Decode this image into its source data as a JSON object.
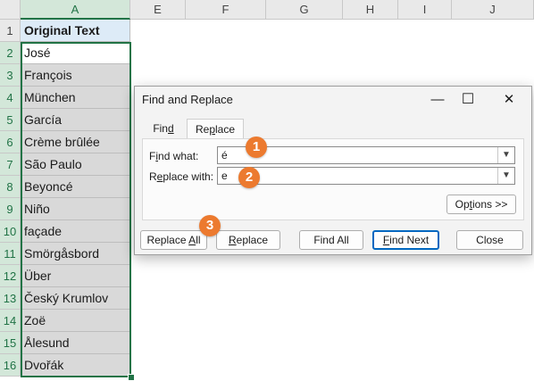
{
  "columns": [
    "A",
    "E",
    "F",
    "G",
    "H",
    "I",
    "J"
  ],
  "rows": [
    {
      "num": "1",
      "value": "Original Text"
    },
    {
      "num": "2",
      "value": "José"
    },
    {
      "num": "3",
      "value": "François"
    },
    {
      "num": "4",
      "value": "München"
    },
    {
      "num": "5",
      "value": "García"
    },
    {
      "num": "6",
      "value": "Crème brûlée"
    },
    {
      "num": "7",
      "value": "São Paulo"
    },
    {
      "num": "8",
      "value": "Beyoncé"
    },
    {
      "num": "9",
      "value": "Niño"
    },
    {
      "num": "10",
      "value": "façade"
    },
    {
      "num": "11",
      "value": "Smörgåsbord"
    },
    {
      "num": "12",
      "value": "Über"
    },
    {
      "num": "13",
      "value": "Český Krumlov"
    },
    {
      "num": "14",
      "value": "Zoë"
    },
    {
      "num": "15",
      "value": "Ålesund"
    },
    {
      "num": "16",
      "value": "Dvořák"
    }
  ],
  "dialog": {
    "title": "Find and Replace",
    "minimize_glyph": "—",
    "maximize_glyph": "☐",
    "close_glyph": "✕",
    "tabs": [
      {
        "label": "Find",
        "underline": "d",
        "before": "Fin",
        "after": ""
      },
      {
        "label": "Replace",
        "before": "Re",
        "underline": "p",
        "after": "lace"
      }
    ],
    "find_what": {
      "before": "F",
      "underline": "i",
      "after": "nd what:",
      "value": "é"
    },
    "replace_with": {
      "before": "R",
      "underline": "e",
      "after": "place with:",
      "value": "e"
    },
    "options_button": {
      "before": "Op",
      "underline": "t",
      "after": "ions >>"
    },
    "buttons": {
      "replace_all": {
        "before": "Replace ",
        "underline": "A",
        "after": "ll"
      },
      "replace": {
        "before": "",
        "underline": "R",
        "after": "eplace"
      },
      "find_all": {
        "before": "Find All",
        "underline": "",
        "after": ""
      },
      "find_next": {
        "before": "",
        "underline": "F",
        "after": "ind Next"
      },
      "close": {
        "before": "Close",
        "underline": "",
        "after": ""
      }
    }
  },
  "callouts": [
    "1",
    "2",
    "3"
  ],
  "colors": {
    "accent_green": "#217346",
    "callout_orange": "#ec7a2f",
    "header_fill": "#ddebf7",
    "selection_fill": "#d9d9d9"
  }
}
